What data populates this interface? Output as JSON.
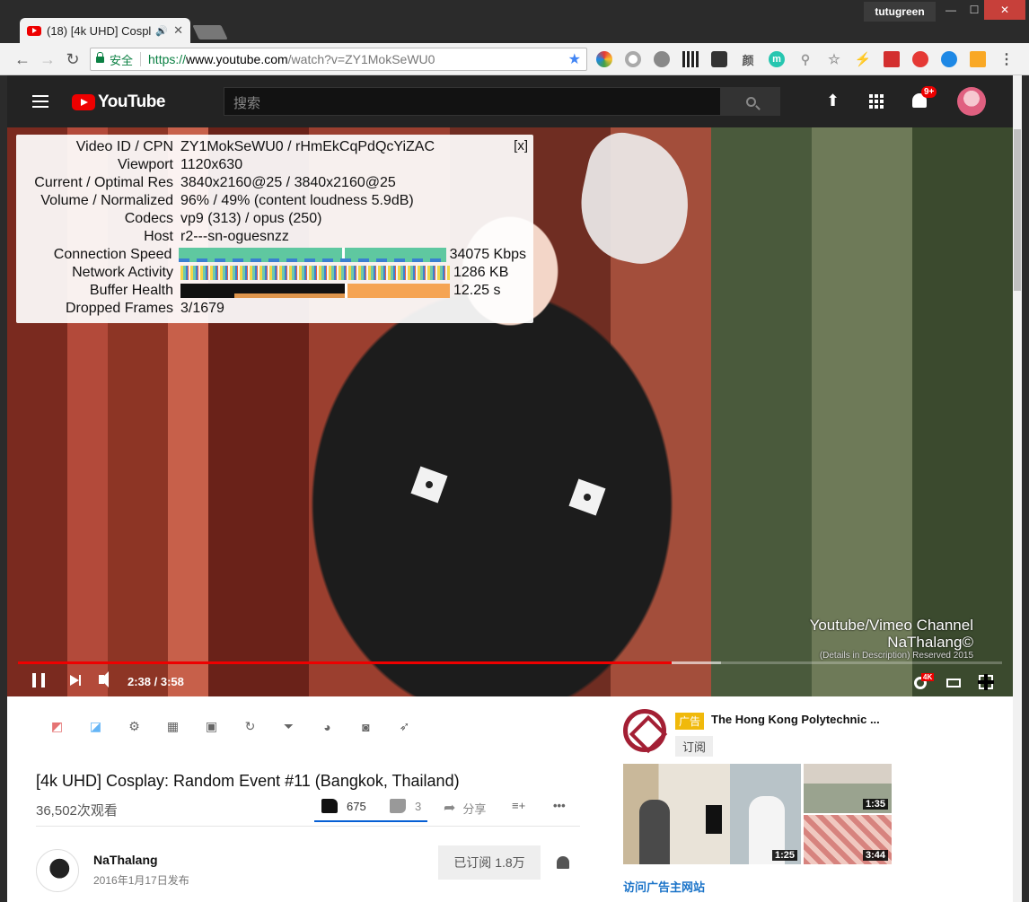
{
  "browser": {
    "tab_title": "(18) [4k UHD] Cospl",
    "tab_audio_icon": "🔊",
    "tab_close": "✕",
    "profile_name": "tutugreen",
    "win_min": "—",
    "win_max": "☐",
    "win_close": "✕",
    "back": "←",
    "forward": "→",
    "reload": "↻",
    "secure_label": "安全",
    "url_proto": "https://",
    "url_host": "www.youtube.com",
    "url_path": "/watch?v=ZY1MokSeWU0",
    "bookmark_star": "★",
    "extension_badge": "6",
    "ext_text_1": "颜",
    "ext_text_2": "m"
  },
  "masthead": {
    "logo_text": "YouTube",
    "search_placeholder": "搜索",
    "notification_count": "9+",
    "upload_icon": "⬆"
  },
  "stats": {
    "close_label": "[x]",
    "rows": [
      {
        "label": "Video ID / CPN",
        "value": "ZY1MokSeWU0 / rHmEkCqPdQcYiZAC"
      },
      {
        "label": "Viewport",
        "value": "1120x630"
      },
      {
        "label": "Current / Optimal Res",
        "value": "3840x2160@25 / 3840x2160@25"
      },
      {
        "label": "Volume / Normalized",
        "value": "96% / 49% (content loudness 5.9dB)"
      },
      {
        "label": "Codecs",
        "value": "vp9 (313) / opus (250)"
      },
      {
        "label": "Host",
        "value": "r2---sn-oguesnzz"
      },
      {
        "label": "Connection Speed",
        "value": "34075 Kbps"
      },
      {
        "label": "Network Activity",
        "value": "1286 KB"
      },
      {
        "label": "Buffer Health",
        "value": "12.25 s"
      },
      {
        "label": "Dropped Frames",
        "value": "3/1679"
      }
    ]
  },
  "player": {
    "time": "2:38 / 3:58",
    "played_fraction": 0.6639,
    "buffered_fraction": 0.7148,
    "quality_badge": "4K",
    "watermark_line1": "Youtube/Vimeo Channel",
    "watermark_line2": "NaThalang©",
    "watermark_line3": "(Details in Description) Reserved 2015"
  },
  "video_info": {
    "tool_icons": [
      "◩",
      "◪",
      "⚙",
      "▦",
      "▣",
      "↻",
      "⏷",
      "◕",
      "◙",
      "➶"
    ],
    "title": "[4k UHD] Cosplay: Random Event #11 (Bangkok, Thailand)",
    "views": "36,502次观看",
    "likes": "675",
    "dislikes": "3",
    "share_label": "分享",
    "share_icon": "➦",
    "add_icon": "≡+",
    "more_icon": "•••",
    "channel_name": "NaThalang",
    "publish_date": "2016年1月17日发布",
    "subscribe_label": "已订阅  1.8万"
  },
  "ad": {
    "tag": "广告",
    "advertiser": "The Hong Kong Polytechnic ...",
    "subscribe": "订阅",
    "durations": [
      "1:25",
      "1:35",
      "3:44"
    ],
    "visit_link": "访问广告主网站"
  }
}
